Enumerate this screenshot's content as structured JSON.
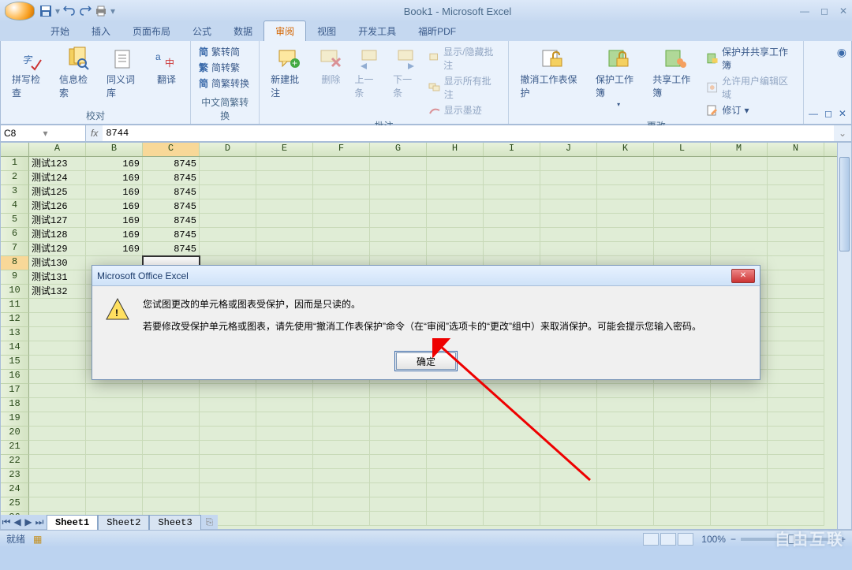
{
  "window": {
    "title": "Book1 - Microsoft Excel"
  },
  "tabs": [
    "开始",
    "插入",
    "页面布局",
    "公式",
    "数据",
    "审阅",
    "视图",
    "开发工具",
    "福昕PDF"
  ],
  "active_tab": 5,
  "ribbon": {
    "proofing_label": "校对",
    "spell": "拼写检查",
    "research": "信息检索",
    "thesaurus": "同义词库",
    "translate": "翻译",
    "chinese_label": "中文简繁转换",
    "simp": "繁转简",
    "trad": "简转繁",
    "convert": "简繁转换",
    "comments_label": "批注",
    "new": "新建批注",
    "delete": "删除",
    "prev": "上一条",
    "next": "下一条",
    "showhide": "显示/隐藏批注",
    "showall": "显示所有批注",
    "showink": "显示墨迹",
    "changes_label": "更改",
    "unprotect": "撤消工作表保护",
    "protectwb": "保护工作簿",
    "sharewb": "共享工作簿",
    "protectshare": "保护并共享工作簿",
    "allowedit": "允许用户编辑区域",
    "track": "修订"
  },
  "namebox": "C8",
  "formula": "8744",
  "cols": [
    "A",
    "B",
    "C",
    "D",
    "E",
    "F",
    "G",
    "H",
    "I",
    "J",
    "K",
    "L",
    "M",
    "N"
  ],
  "active_cell": {
    "row": 8,
    "col": 2
  },
  "data_rows": [
    {
      "a": "测试123",
      "b": "169",
      "c": "8745"
    },
    {
      "a": "测试124",
      "b": "169",
      "c": "8745"
    },
    {
      "a": "测试125",
      "b": "169",
      "c": "8745"
    },
    {
      "a": "测试126",
      "b": "169",
      "c": "8745"
    },
    {
      "a": "测试127",
      "b": "169",
      "c": "8745"
    },
    {
      "a": "测试128",
      "b": "169",
      "c": "8745"
    },
    {
      "a": "测试129",
      "b": "169",
      "c": "8745"
    },
    {
      "a": "测试130",
      "b": "",
      "c": ""
    },
    {
      "a": "测试131",
      "b": "",
      "c": ""
    },
    {
      "a": "测试132",
      "b": "",
      "c": ""
    }
  ],
  "total_rows": 26,
  "sheets": [
    "Sheet1",
    "Sheet2",
    "Sheet3"
  ],
  "active_sheet": 0,
  "status": {
    "ready": "就绪",
    "zoom": "100%"
  },
  "dialog": {
    "title": "Microsoft Office Excel",
    "line1": "您试图更改的单元格或图表受保护，因而是只读的。",
    "line2": "若要修改受保护单元格或图表，请先使用“撤消工作表保护”命令（在“审阅”选项卡的“更改”组中）来取消保护。可能会提示您输入密码。",
    "ok": "确定"
  },
  "watermark": "自由互联"
}
